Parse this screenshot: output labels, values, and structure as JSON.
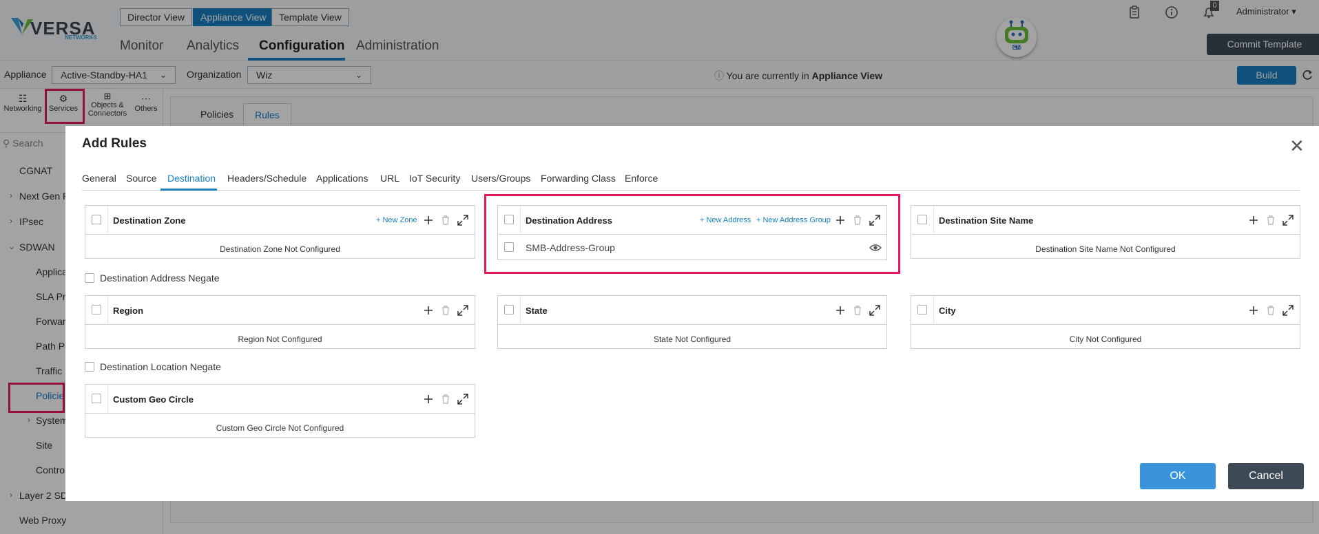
{
  "brand": {
    "name": "VERSA",
    "sub": "NETWORKS"
  },
  "view_switch": {
    "director": "Director View",
    "appliance": "Appliance View",
    "template": "Template View"
  },
  "main_tabs": [
    "Monitor",
    "Analytics",
    "Configuration",
    "Administration"
  ],
  "notifications": {
    "count": "0"
  },
  "user": {
    "name": "Administrator ▾"
  },
  "commit_button": "Commit Template",
  "mascot_badge": "BETA",
  "context_bar": {
    "appliance_label": "Appliance",
    "appliance_value": "Active-Standby-HA1",
    "org_label": "Organization",
    "org_value": "Wiz",
    "notice_prefix": "You are currently in",
    "notice_strong": "Appliance View",
    "build": "Build"
  },
  "sidebar": {
    "icons": {
      "networking": "Networking",
      "services": "Services",
      "objects": "Objects & Connectors",
      "others": "Others"
    },
    "search_placeholder": "Search",
    "items": [
      "CGNAT",
      "Next Gen F",
      "IPsec",
      "SDWAN",
      "Applica",
      "SLA Pr",
      "Forwar",
      "Path Po",
      "Traffic",
      "Policie",
      "System",
      "Site",
      "Contro",
      "Layer 2 SD",
      "Web Proxy"
    ]
  },
  "content_tabs": {
    "policies": "Policies",
    "rules": "Rules"
  },
  "modal": {
    "title": "Add Rules",
    "tabs": [
      "General",
      "Source",
      "Destination",
      "Headers/Schedule",
      "Applications",
      "URL",
      "IoT Security",
      "Users/Groups",
      "Forwarding Class",
      "Enforce"
    ],
    "panels": {
      "zone": {
        "title": "Destination Zone",
        "link": "+ New Zone",
        "empty": "Destination Zone Not Configured"
      },
      "address": {
        "title": "Destination Address",
        "link1": "+ New Address",
        "link2": "+ New Address Group",
        "row": "SMB-Address-Group"
      },
      "site": {
        "title": "Destination Site Name",
        "empty": "Destination Site Name Not Configured"
      },
      "region": {
        "title": "Region",
        "empty": "Region Not Configured"
      },
      "state": {
        "title": "State",
        "empty": "State Not Configured"
      },
      "city": {
        "title": "City",
        "empty": "City Not Configured"
      },
      "geo": {
        "title": "Custom Geo Circle",
        "empty": "Custom Geo Circle Not Configured"
      }
    },
    "address_negate": "Destination Address Negate",
    "location_negate": "Destination Location Negate",
    "ok": "OK",
    "cancel": "Cancel"
  },
  "colors": {
    "accent": "#1a7fc1",
    "highlight": "#e3195e",
    "dark_button": "#3d4a56"
  }
}
